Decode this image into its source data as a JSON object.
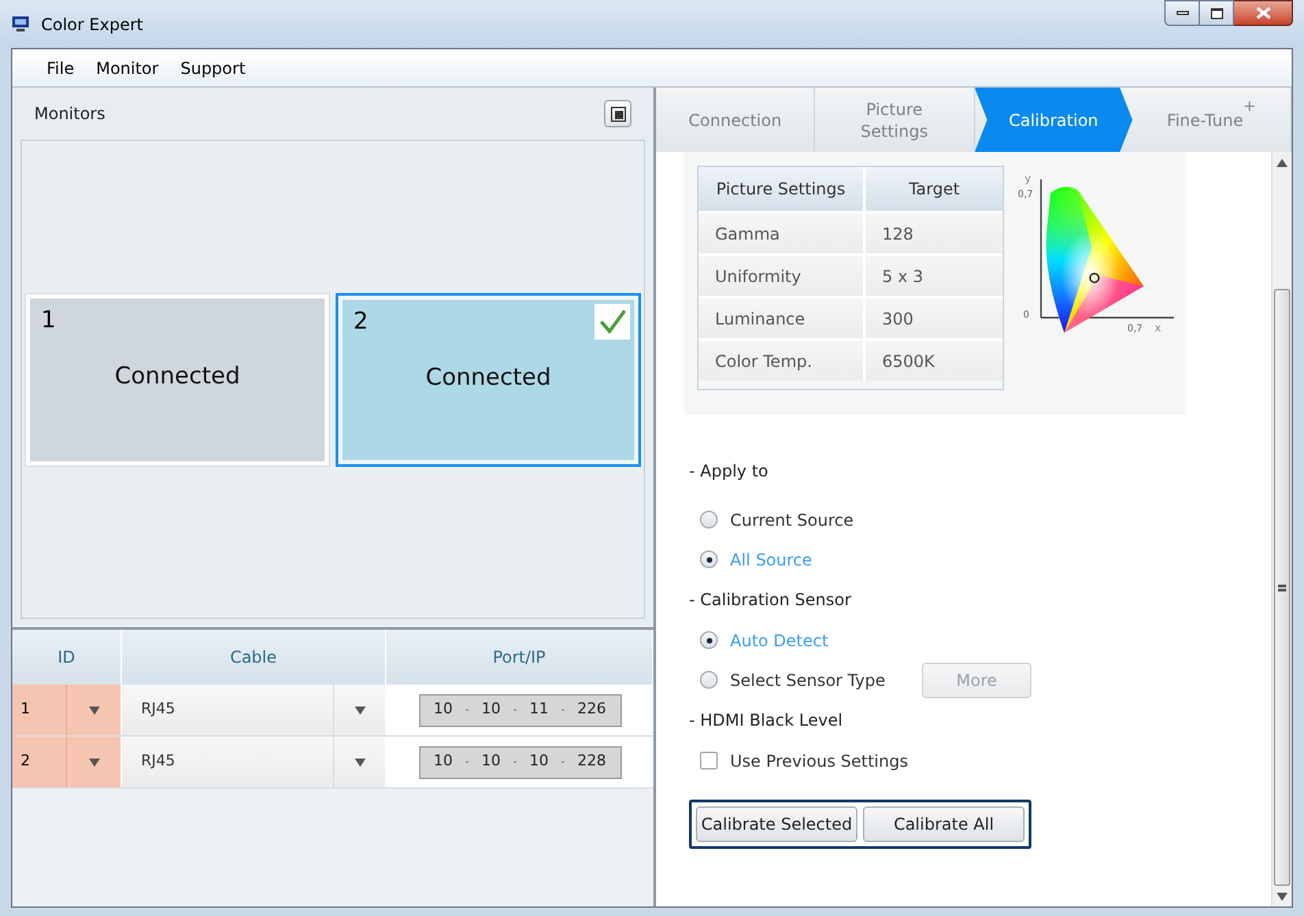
{
  "window": {
    "title": "Color Expert"
  },
  "menu": [
    "File",
    "Monitor",
    "Support"
  ],
  "monitors_panel": {
    "title": "Monitors",
    "monitors": [
      {
        "number": "1",
        "status": "Connected",
        "selected": false
      },
      {
        "number": "2",
        "status": "Connected",
        "selected": true
      }
    ]
  },
  "connection_table": {
    "columns": [
      "ID",
      "Cable",
      "Port/IP"
    ],
    "rows": [
      {
        "id": "1",
        "cable": "RJ45",
        "ip": [
          "10",
          "10",
          "11",
          "226"
        ]
      },
      {
        "id": "2",
        "cable": "RJ45",
        "ip": [
          "10",
          "10",
          "10",
          "228"
        ]
      }
    ]
  },
  "steps": [
    {
      "label": "Connection",
      "selected": false
    },
    {
      "label": "Picture Settings",
      "selected": false
    },
    {
      "label": "Calibration",
      "selected": true
    },
    {
      "label": "Fine-Tune",
      "mark": "+",
      "selected": false
    }
  ],
  "settings_table": {
    "columns": [
      "Picture Settings",
      "Target"
    ],
    "rows": [
      [
        "Gamma",
        "128"
      ],
      [
        "Uniformity",
        "5 x 3"
      ],
      [
        "Luminance",
        "300"
      ],
      [
        "Color Temp.",
        "6500K"
      ]
    ]
  },
  "chromaticity": {
    "y_axis": "y",
    "x_axis": "x",
    "y_tick": "0,7",
    "x_tick": "0,7",
    "origin": "0"
  },
  "sections": [
    {
      "title": "- Apply to",
      "options": [
        {
          "kind": "radio",
          "label": "Current Source",
          "selected": false
        },
        {
          "kind": "radio",
          "label": "All Source",
          "selected": true
        }
      ]
    },
    {
      "title": "- Calibration Sensor",
      "options": [
        {
          "kind": "radio",
          "label": "Auto Detect",
          "selected": true
        },
        {
          "kind": "radio",
          "label": "Select Sensor Type",
          "selected": false,
          "button": "More"
        }
      ]
    },
    {
      "title": "- HDMI Black Level",
      "options": [
        {
          "kind": "checkbox",
          "label": "Use Previous Settings",
          "checked": false
        }
      ]
    }
  ],
  "actions": [
    "Calibrate Selected",
    "Calibrate All"
  ]
}
